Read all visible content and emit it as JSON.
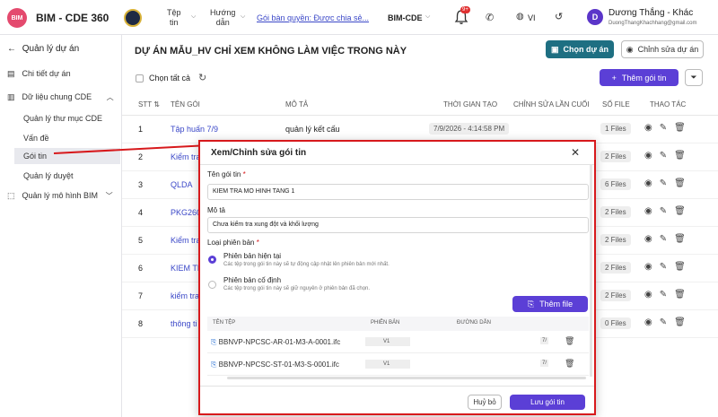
{
  "header": {
    "logo_text": "BIM",
    "brand": "BIM - CDE 360",
    "nav_files": [
      "Tệp",
      "tin"
    ],
    "nav_guide": [
      "Hướng",
      "dẫn"
    ],
    "package_link": "Gói bàn quyền: Được chia sẻ...",
    "project_select": "BIM-CDE",
    "notification_count": "9+",
    "language": "VI",
    "avatar_letter": "D",
    "user_name": "Dương Thắng - Khác",
    "user_email": "DuongThangKhachhang@gmail.com"
  },
  "sidebar": {
    "back_label": "Quản lý dự án",
    "items": [
      {
        "label": "Chi tiết dự án"
      },
      {
        "label": "Dữ liệu chung CDE"
      },
      {
        "label": "Quản lý thư mục CDE"
      },
      {
        "label": "Vấn đề"
      },
      {
        "label": "Gói tin"
      },
      {
        "label": "Quản lý duyệt"
      },
      {
        "label": "Quản lý mô hình BIM"
      }
    ]
  },
  "main": {
    "project_title": "DỰ ÁN MẪU_HV CHỈ XEM KHÔNG LÀM VIỆC TRONG NÀY",
    "choose_project": "Chọn dự án",
    "edit_project": "Chỉnh sửa dự án",
    "select_all": "Chọn tất cả",
    "add_package": "Thêm gói tin",
    "columns": [
      "STT",
      "TÊN GÓI",
      "MÔ TẢ",
      "THỜI GIAN TẠO",
      "CHỈNH SỬA LẦN CUỐI",
      "SỐ FILE",
      "THAO TÁC"
    ],
    "rows": [
      {
        "stt": "1",
        "name": "Tập huấn 7/9",
        "desc": "quản lý kết cấu",
        "created": "7/9/2026 - 4:14:58 PM",
        "files": "1 Files"
      },
      {
        "stt": "2",
        "name": "Kiểm tra",
        "desc": "",
        "created": "",
        "files": "2 Files"
      },
      {
        "stt": "3",
        "name": "QLDA",
        "desc": "",
        "created": "",
        "files": "6 Files"
      },
      {
        "stt": "4",
        "name": "PKG260",
        "desc": "",
        "created": "",
        "files": "2 Files"
      },
      {
        "stt": "5",
        "name": "Kiểm tra",
        "desc": "",
        "created": "",
        "files": "2 Files"
      },
      {
        "stt": "6",
        "name": "KIEM TR",
        "desc": "",
        "created": "",
        "files": "2 Files"
      },
      {
        "stt": "7",
        "name": "kiểm tra",
        "desc": "",
        "created": "",
        "files": "2 Files"
      },
      {
        "stt": "8",
        "name": "thông ti",
        "desc": "",
        "created": "",
        "files": "0 Files"
      }
    ]
  },
  "modal": {
    "title": "Xem/Chỉnh sửa gói tin",
    "name_label": "Tên gói tin",
    "name_value": "KIEM TRA MO HINH TANG 1",
    "desc_label": "Mô tả",
    "desc_value": "Chưa kiểm tra xung đột và khối lượng",
    "version_label": "Loại phiên bản",
    "option_current_title": "Phiên bản hiện tại",
    "option_current_desc": "Các tệp trong gói tin này sẽ tự động cập nhật lên phiên bản mới nhất.",
    "option_fixed_title": "Phiên bản cố định",
    "option_fixed_desc": "Các tệp trong gói tin này sẽ giữ nguyên ở phiên bản đã chọn.",
    "add_file": "Thêm file",
    "file_columns": [
      "TÊN TỆP",
      "PHIÊN BẢN",
      "ĐƯỜNG DẪN"
    ],
    "files": [
      {
        "name": "BBNVP-NPCSC-AR-01-M3-A-0001.ifc",
        "version": "V1",
        "path": "7/"
      },
      {
        "name": "BBNVP-NPCSC-ST-01-M3-S-0001.ifc",
        "version": "V1",
        "path": "7/"
      }
    ],
    "cancel": "Huỷ bỏ",
    "save": "Lưu gói tin"
  }
}
